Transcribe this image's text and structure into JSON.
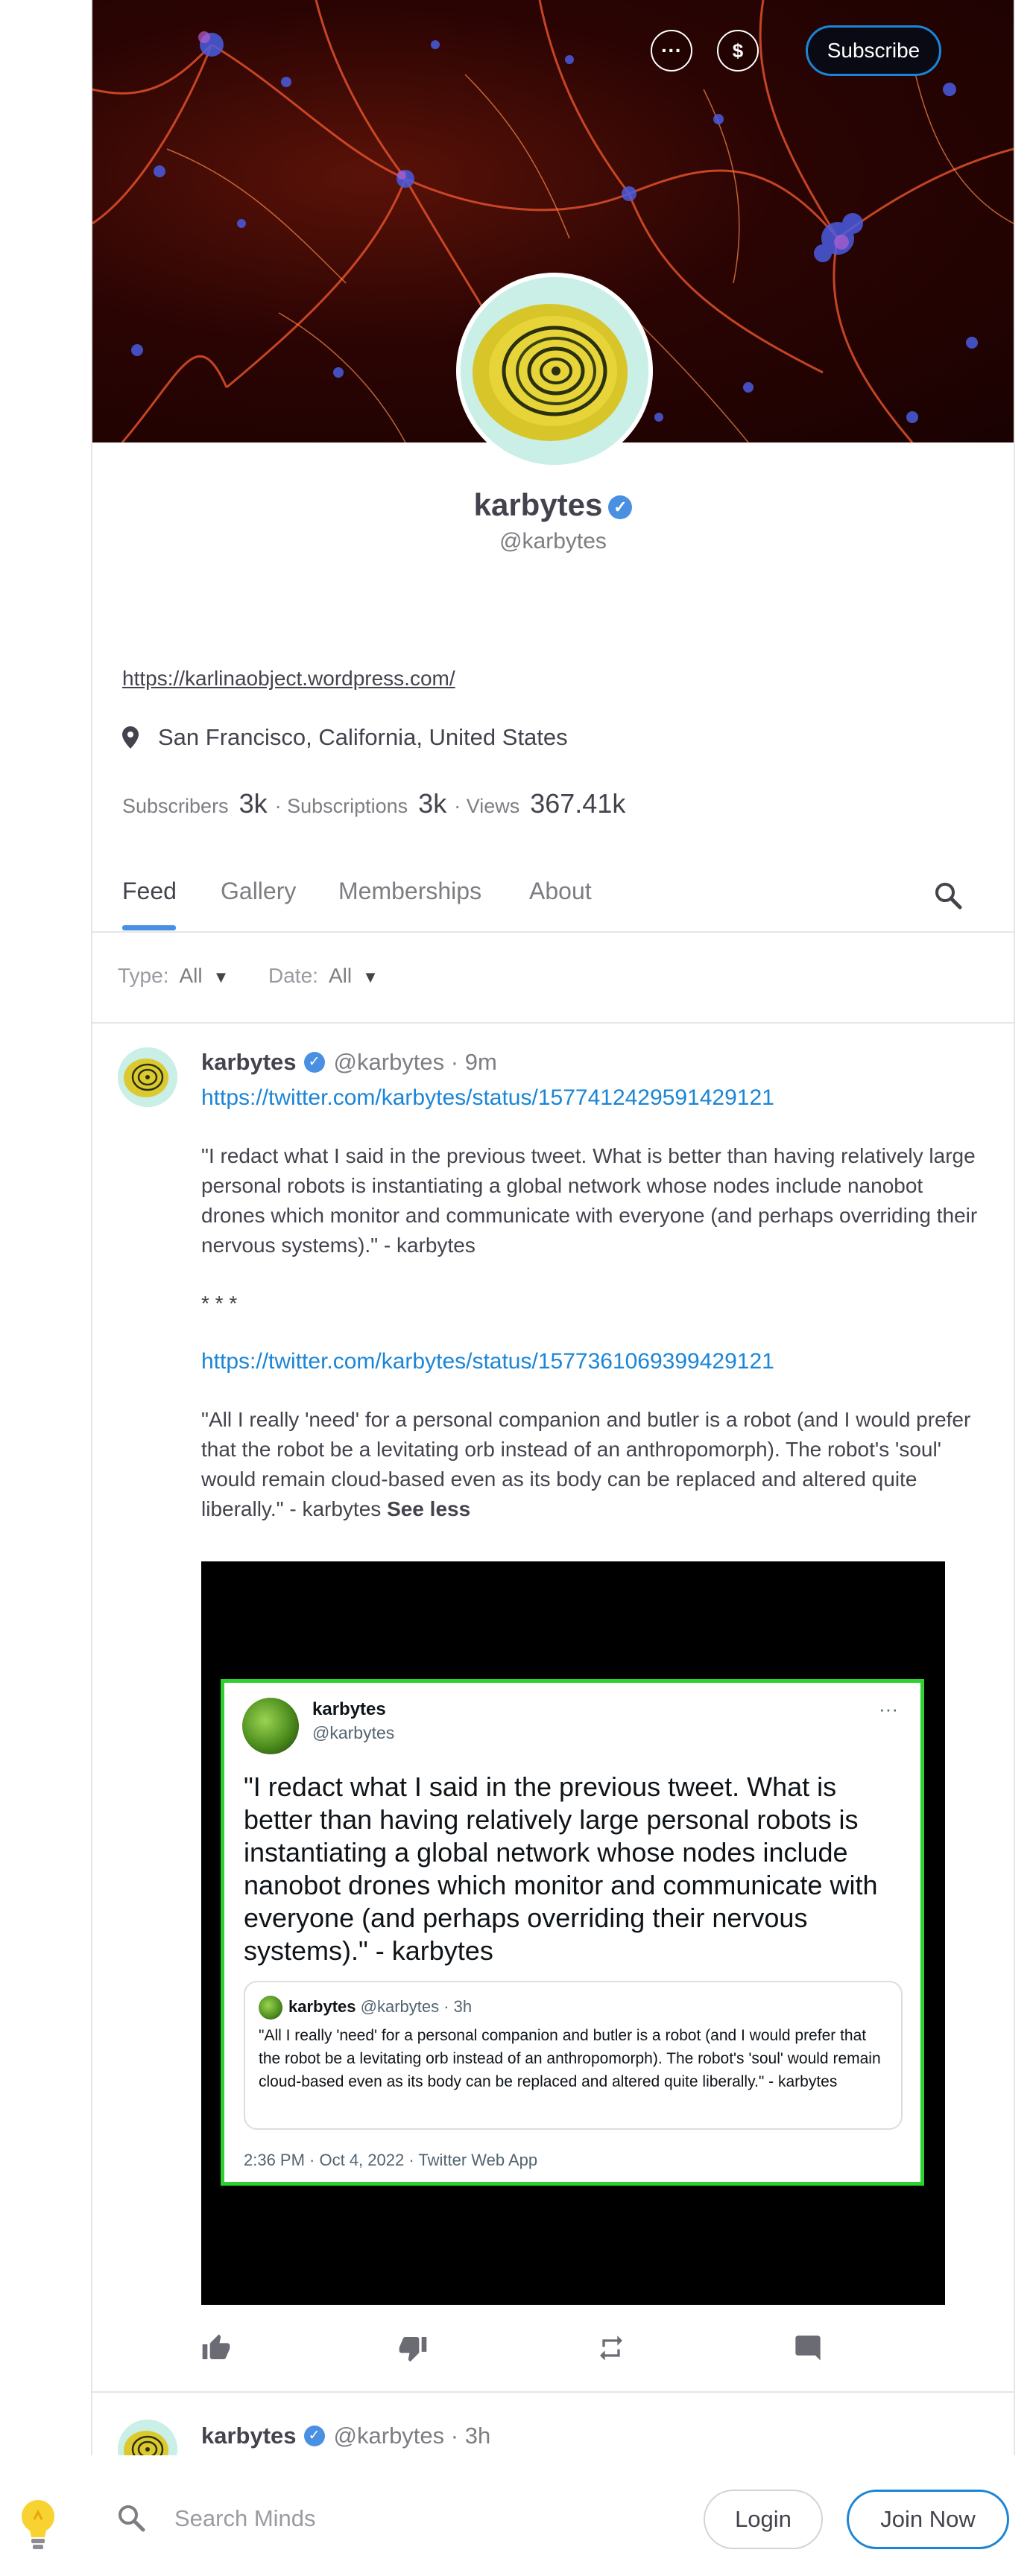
{
  "header": {
    "more_icon": "ellipsis-icon",
    "tip_icon": "dollar-icon",
    "subscribe_label": "Subscribe"
  },
  "profile": {
    "name": "karbytes",
    "handle": "@karbytes",
    "url": "https://karlinaobject.wordpress.com/",
    "location": "San Francisco, California, United States",
    "stats": {
      "subscribers_label": "Subscribers",
      "subscribers": "3k",
      "subscriptions_label": "· Subscriptions",
      "subscriptions": "3k",
      "views_label": "· Views",
      "views": "367.41k"
    }
  },
  "tabs": [
    {
      "label": "Feed",
      "active": true
    },
    {
      "label": "Gallery",
      "active": false
    },
    {
      "label": "Memberships",
      "active": false
    },
    {
      "label": "About",
      "active": false
    }
  ],
  "filters": {
    "type_label": "Type:",
    "type_value": "All",
    "date_label": "Date:",
    "date_value": "All"
  },
  "post": {
    "author": "karbytes",
    "meta": "@karbytes · 9m",
    "link1": "https://twitter.com/karbytes/status/1577412429591429121",
    "para1": "\"I redact what I said in the previous tweet. What is better than having relatively large personal robots is instantiating a global network whose nodes include nanobot drones which monitor and communicate with everyone (and perhaps overriding their nervous systems).\" - karbytes",
    "separator": "* * *",
    "link2": "https://twitter.com/karbytes/status/1577361069399429121",
    "para2": "\"All I really 'need' for a personal companion and butler is a robot (and I would prefer that the robot be a levitating orb instead of an anthropomorph). The robot's 'soul' would remain cloud-based even as its body can be replaced and altered quite liberally.\" - karbytes",
    "see_less": "See less",
    "tweet": {
      "name": "karbytes",
      "handle": "@karbytes",
      "more": "···",
      "text": "\"I redact what I said in the previous tweet. What is better than having relatively large personal robots is instantiating a global network whose nodes include nanobot drones which monitor and communicate with everyone (and perhaps overriding their nervous systems).\" - karbytes",
      "quote_name": "karbytes",
      "quote_meta": "@karbytes · 3h",
      "quote_text": "\"All I really 'need' for a personal companion and butler is a robot (and I would prefer that the robot be a levitating orb instead of an anthropomorph). The robot's 'soul' would remain cloud-based even as its body can be replaced and altered quite liberally.\" - karbytes",
      "timestamp": "2:36 PM · Oct 4, 2022 · Twitter Web App"
    }
  },
  "post2": {
    "author": "karbytes",
    "meta": "@karbytes · 3h"
  },
  "bottom_bar": {
    "search_placeholder": "Search Minds",
    "login_label": "Login",
    "join_label": "Join Now"
  },
  "colors": {
    "accent": "#4a90e2",
    "link": "#1b85d6",
    "tweet_border": "#2ed12e"
  }
}
